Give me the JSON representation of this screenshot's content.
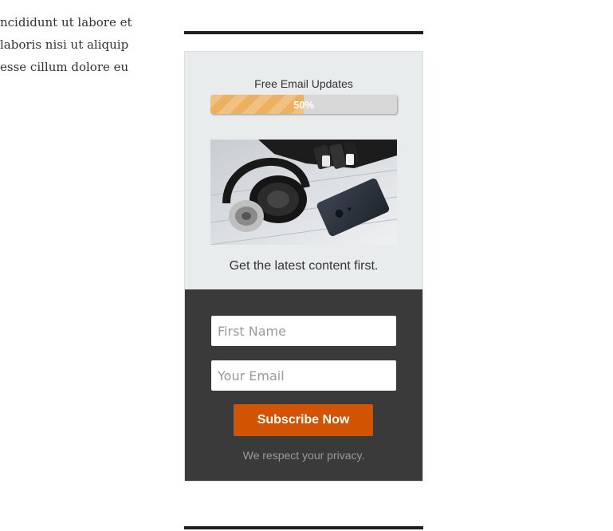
{
  "article": {
    "lines": [
      "ncididunt ut labore et",
      "laboris nisi ut aliquip",
      "esse cillum dolore eu"
    ]
  },
  "optin": {
    "progress": {
      "label": "Free Email Updates",
      "percent": 50,
      "percent_text": "50%",
      "fill_color": "#ebb15f"
    },
    "image": {
      "subject": "headphones and smartphone on white desk"
    },
    "tagline": "Get the latest content first.",
    "form": {
      "first_name_placeholder": "First Name",
      "email_placeholder": "Your Email",
      "submit_label": "Subscribe Now",
      "submit_color": "#d35400"
    },
    "privacy_text": "We respect your privacy.",
    "top_bg_color": "#e9eced",
    "bottom_bg_color": "#3a3a3a"
  }
}
